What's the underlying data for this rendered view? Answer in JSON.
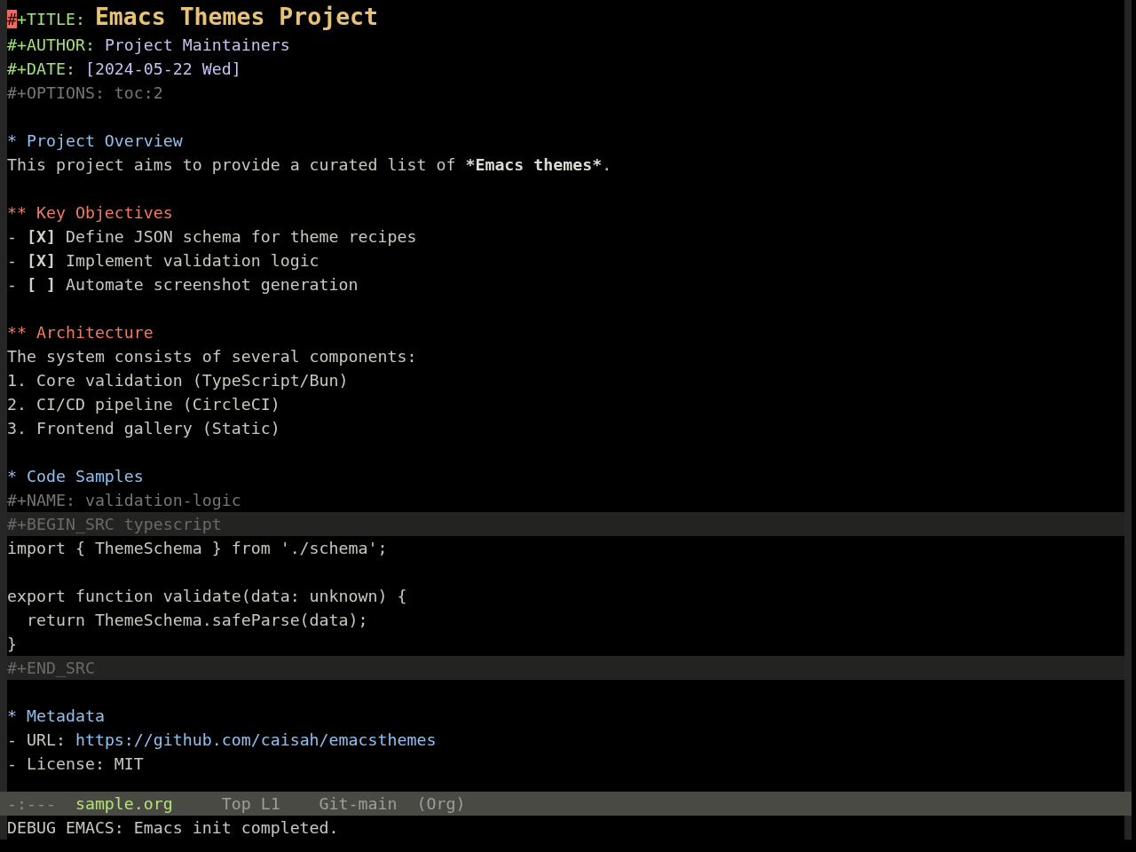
{
  "buffer": {
    "header": [
      {
        "kind": "title",
        "key": "#+TITLE:",
        "value": "Emacs Themes Project",
        "cursor": true
      },
      {
        "kind": "info",
        "key": "#+AUTHOR:",
        "value": "Project Maintainers",
        "cursor": false
      },
      {
        "kind": "info",
        "key": "#+DATE:",
        "value": "[2024-05-22 Wed]",
        "cursor": false
      },
      {
        "kind": "setting",
        "text": "#+OPTIONS: toc:2",
        "cursor": false
      }
    ],
    "sections": [
      {
        "heading": "* Project Overview",
        "body": [
          {
            "kind": "paragraph",
            "parts": [
              {
                "text": "This project aims to provide a curated list of ",
                "bold": false
              },
              {
                "text": "*Emacs themes*",
                "bold": true
              },
              {
                "text": ".",
                "bold": false
              }
            ]
          }
        ],
        "children": [
          {
            "heading": "** Key Objectives",
            "body": [
              {
                "kind": "task",
                "bullet": "-",
                "box": "[X]",
                "text": "Define JSON schema for theme recipes"
              },
              {
                "kind": "task",
                "bullet": "-",
                "box": "[X]",
                "text": "Implement validation logic"
              },
              {
                "kind": "task",
                "bullet": "-",
                "box": "[ ]",
                "text": "Automate screenshot generation"
              }
            ]
          },
          {
            "heading": "** Architecture",
            "body": [
              {
                "kind": "paragraph",
                "parts": [
                  {
                    "text": "The system consists of several components:",
                    "bold": false
                  }
                ]
              },
              {
                "kind": "item",
                "text": "1. Core validation (TypeScript/Bun)"
              },
              {
                "kind": "item",
                "text": "2. CI/CD pipeline (CircleCI)"
              },
              {
                "kind": "item",
                "text": "3. Frontend gallery (Static)"
              }
            ]
          }
        ]
      },
      {
        "heading": "* Code Samples",
        "body": [
          {
            "kind": "setting",
            "text": "#+NAME: validation-logic"
          },
          {
            "kind": "src_block",
            "begin": "#+BEGIN_SRC typescript",
            "lines": [
              {
                "kind": "code",
                "text": "import { ThemeSchema } from './schema';"
              },
              {
                "kind": "blank"
              },
              {
                "kind": "code",
                "text": "export function validate(data: unknown) {"
              },
              {
                "kind": "code",
                "text": "  return ThemeSchema.safeParse(data);"
              },
              {
                "kind": "code",
                "text": "}"
              }
            ],
            "end": "#+END_SRC"
          }
        ]
      },
      {
        "heading": "* Metadata",
        "body": [
          {
            "kind": "link_item",
            "label": "- URL:",
            "link": "https://github.com/caisah/emacsthemes"
          },
          {
            "kind": "item",
            "text": "- License: MIT"
          }
        ]
      }
    ]
  },
  "mode_line": [
    {
      "kind": "state",
      "text": "-:---"
    },
    {
      "kind": "buffer",
      "text": "sample.org"
    },
    {
      "kind": "position",
      "text": "Top L1"
    },
    {
      "kind": "vc",
      "text": "Git-main"
    },
    {
      "kind": "mode",
      "text": "(Org)"
    }
  ],
  "echo_area": {
    "message": "DEBUG EMACS: Emacs init completed."
  }
}
